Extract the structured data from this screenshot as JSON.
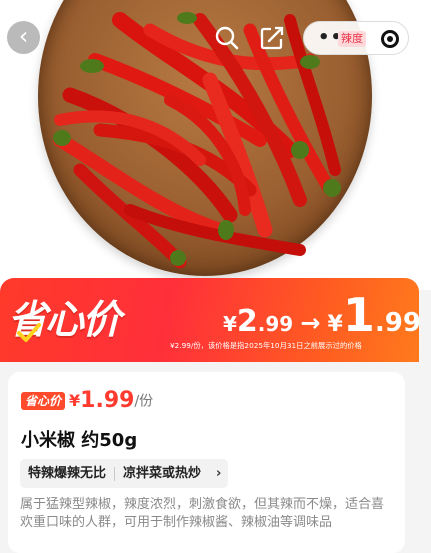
{
  "hero": {
    "back_icon": "chevron-left-icon",
    "search_icon": "search-icon",
    "share_icon": "share-edit-icon",
    "capsule": {
      "more_icon": "more-dots-icon",
      "more_text": "••",
      "badge_text": "辣度",
      "target_icon": "target-icon"
    }
  },
  "banner": {
    "logo_text": "省心价",
    "original_currency": "¥",
    "original_int": "2",
    "original_dec": ".99",
    "arrow": "→",
    "final_currency": "¥",
    "final_int": "1",
    "final_dec": ".99",
    "note": "¥2.99/份，该价格是指2025年10月31日之前展示过的价格"
  },
  "product": {
    "tag": "省心价",
    "currency": "¥",
    "price": "1.99",
    "unit": "/份",
    "title": "小米椒 约50g",
    "chips": [
      "特辣爆辣无比",
      "凉拌菜或热炒"
    ],
    "chips_more": "›",
    "description": "属于猛辣型辣椒，辣度浓烈，刺激食欲，但其辣而不燥，适合喜欢重口味的人群，可用于制作辣椒酱、辣椒油等调味品"
  },
  "colors": {
    "banner_red": "#ff3a2a",
    "banner_orange": "#ff7a1c",
    "price_red": "#ff3b2f"
  }
}
